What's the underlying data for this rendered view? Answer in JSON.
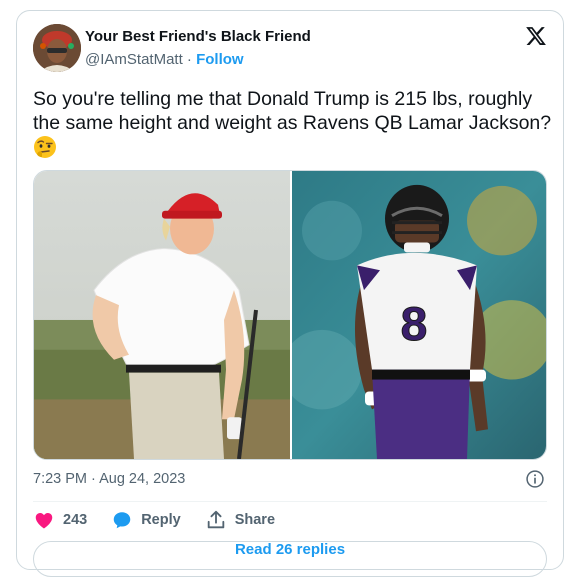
{
  "author": {
    "display_name": "Your Best Friend's Black Friend",
    "handle": "@IAmStatMatt",
    "separator": "·",
    "follow_label": "Follow"
  },
  "tweet": {
    "text": "So you're telling me that Donald Trump is 215 lbs, roughly the same height and weight as Ravens QB Lamar Jackson?",
    "emoji": "face-with-raised-eyebrow",
    "timestamp": "7:23 PM · Aug 24, 2023"
  },
  "media": {
    "left_photo": "man-in-white-polo-and-red-cap-golfing",
    "right_photo": "ravens-quarterback-number-8"
  },
  "actions": {
    "like_count": "243",
    "reply_label": "Reply",
    "share_label": "Share"
  },
  "footer": {
    "read_replies_label": "Read 26 replies"
  },
  "colors": {
    "accent": "#1d9bf0",
    "like": "#f91880",
    "text": "#0f1419",
    "muted": "#536471",
    "border": "#cfd9de"
  }
}
